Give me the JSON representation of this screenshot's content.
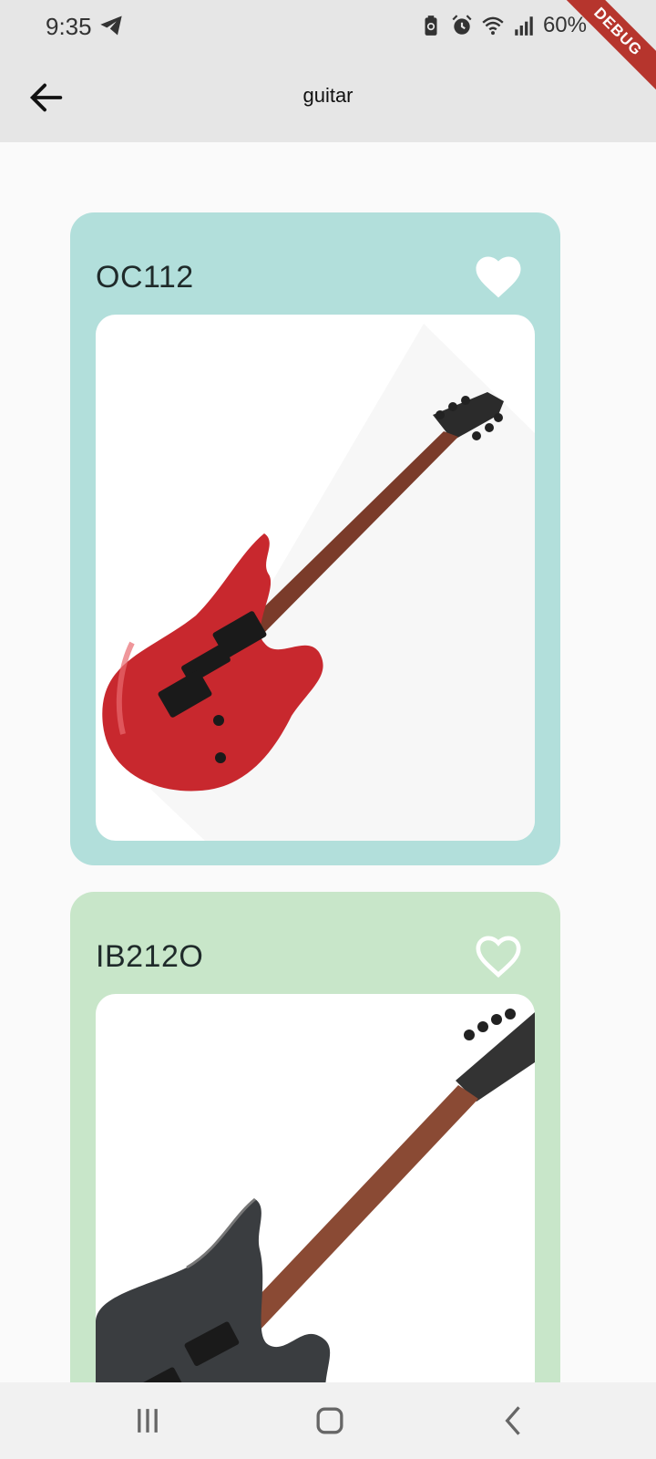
{
  "status_bar": {
    "time": "9:35",
    "battery": "60%",
    "icons": [
      "telegram-icon",
      "battery-saver-icon",
      "alarm-icon",
      "wifi-icon",
      "signal-icon"
    ]
  },
  "debug_banner": "DEBUG",
  "app_bar": {
    "title": "guitar",
    "back_icon": "arrow-left-icon"
  },
  "products": [
    {
      "name": "OC112",
      "favorite": true,
      "card_color": "#b2dfdb",
      "image": "red-electric-guitar"
    },
    {
      "name": "IB212O",
      "favorite": false,
      "card_color": "#c8e6c9",
      "image": "black-electric-guitar"
    }
  ],
  "nav_bar": {
    "icons": [
      "recent-apps-icon",
      "home-icon",
      "back-icon"
    ]
  }
}
